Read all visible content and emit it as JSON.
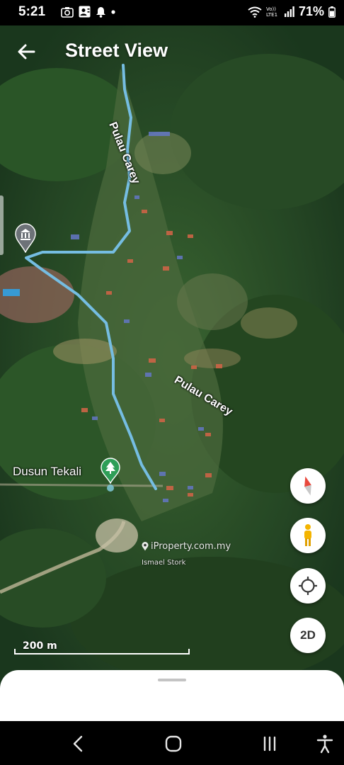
{
  "status_bar": {
    "time": "5:21",
    "battery": "71%",
    "network_label": "Vo)) LTE1"
  },
  "header": {
    "title": "Street View"
  },
  "map": {
    "labels": {
      "road_upper": "Pulau Carey",
      "road_lower": "Pulau Carey",
      "place": "Dusun Tekali"
    },
    "watermark": "iProperty.com.my",
    "watermark_credit": "Ismael Stork",
    "scale_label": "200 m",
    "route_color": "#7cc8ef",
    "park_pin_color": "#2e9e57"
  },
  "controls": {
    "view_mode_label": "2D",
    "icons": [
      "compass-icon",
      "pegman-icon",
      "my-location-icon"
    ]
  },
  "nav_bar": {
    "icons": [
      "back-nav-icon",
      "home-nav-icon",
      "recents-nav-icon",
      "accessibility-icon"
    ]
  }
}
